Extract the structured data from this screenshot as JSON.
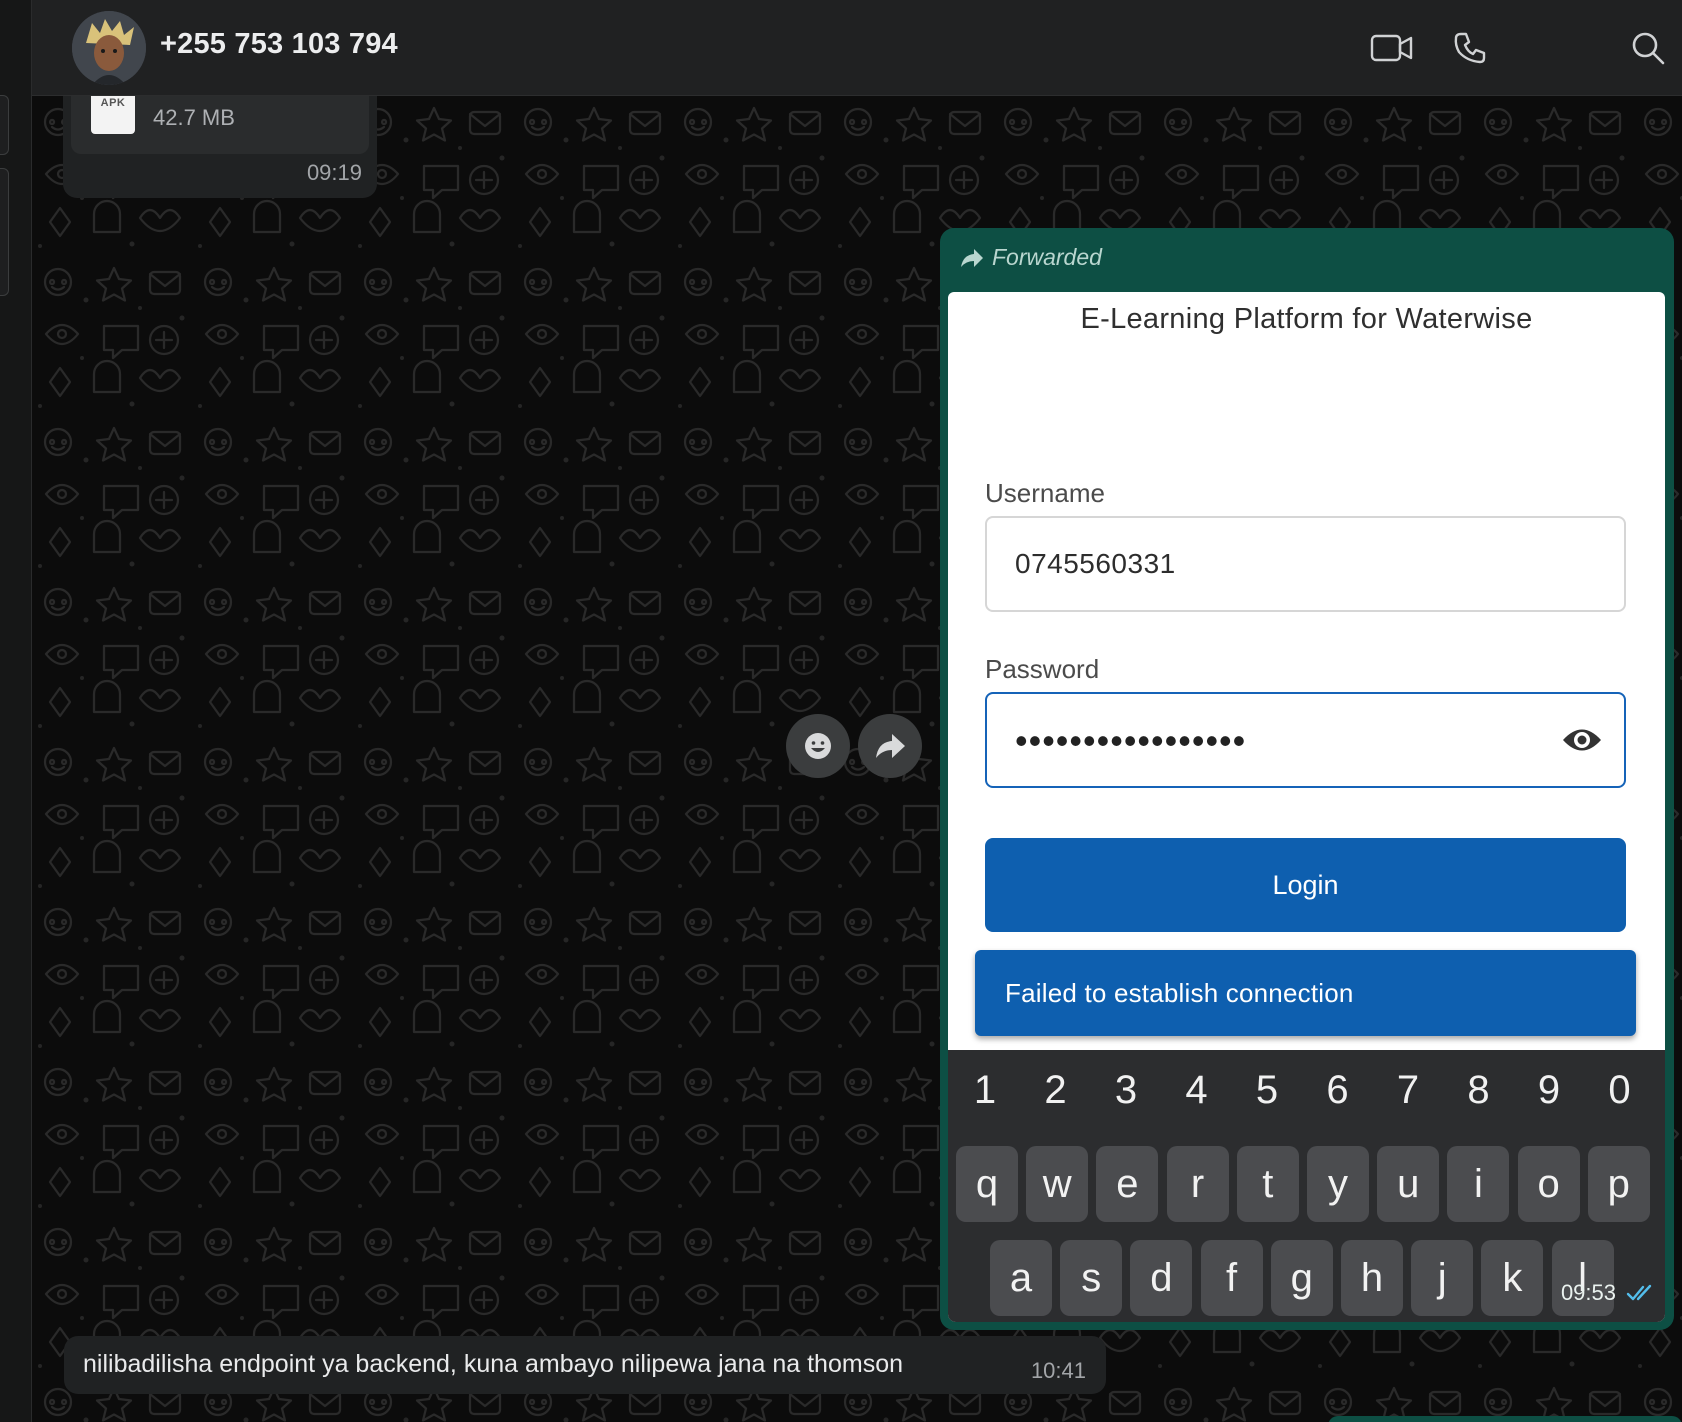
{
  "header": {
    "contact_name": "+255 753 103 794",
    "icons": [
      "avatar",
      "video-call-icon",
      "voice-call-icon",
      "search-icon"
    ]
  },
  "messages": {
    "file_message": {
      "file_type": "APK",
      "file_size": "42.7 MB",
      "time": "09:19"
    },
    "forwarded_message": {
      "forwarded_label": "Forwarded",
      "time": "09:53",
      "status_icon": "double-check-read-icon",
      "screenshot": {
        "title": "E-Learning Platform for Waterwise",
        "username_label": "Username",
        "username_value": "0745560331",
        "password_label": "Password",
        "password_value": "•••••••••••••••••",
        "login_label": "Login",
        "error_text": "Failed to establish connection",
        "keyboard": {
          "numbers": [
            "1",
            "2",
            "3",
            "4",
            "5",
            "6",
            "7",
            "8",
            "9",
            "0"
          ],
          "row1": [
            "q",
            "w",
            "e",
            "r",
            "t",
            "y",
            "u",
            "i",
            "o",
            "p"
          ],
          "row2": [
            "a",
            "s",
            "d",
            "f",
            "g",
            "h",
            "j",
            "k",
            "l"
          ]
        }
      }
    },
    "text_message": {
      "text": "nilibadilisha endpoint ya backend, kuna ambayo nilipewa jana na thomson",
      "time": "10:41"
    }
  },
  "hover_actions": [
    "emoji-reaction-icon",
    "forward-icon"
  ],
  "colors": {
    "outgoing_bubble": "#0d4f44",
    "incoming_bubble": "#202223",
    "header_bg": "#202122",
    "app_primary": "#0e5faf",
    "read_ticks": "#53bdeb"
  }
}
